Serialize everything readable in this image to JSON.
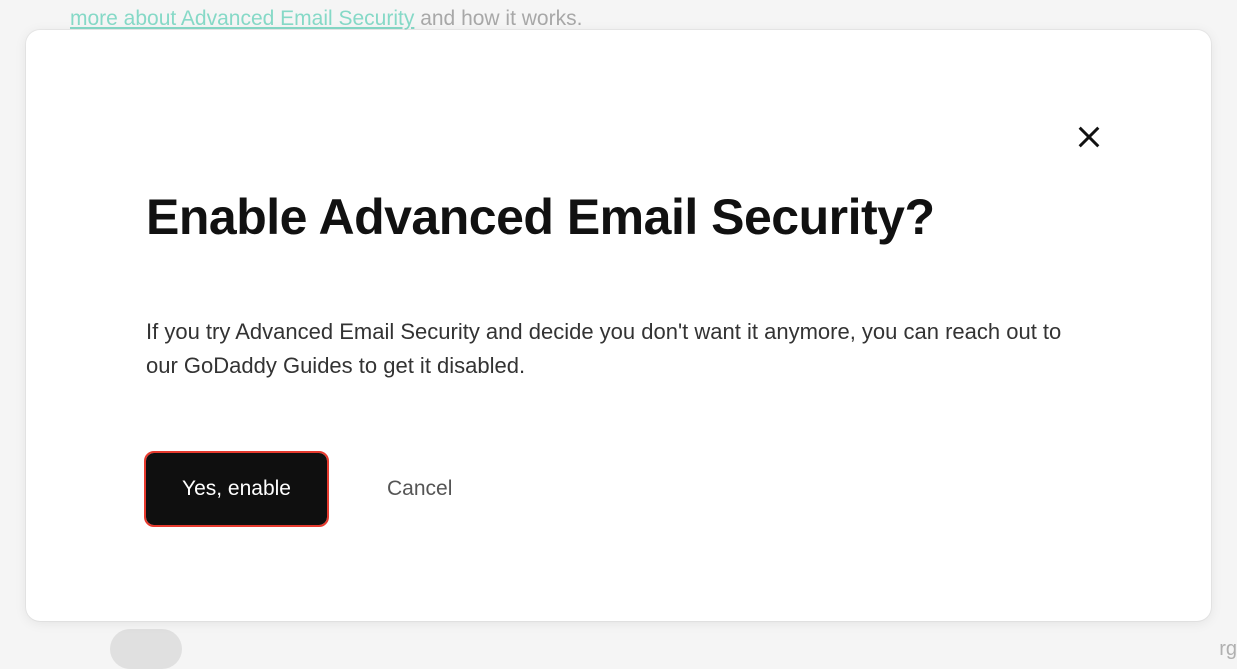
{
  "background": {
    "link_text": "more about Advanced Email Security",
    "trailing_text": " and how it works.",
    "right_fragment": "rg"
  },
  "modal": {
    "title": "Enable Advanced Email Security?",
    "body": "If you try Advanced Email Security and decide you don't want it anymore, you can reach out to our GoDaddy Guides to get it disabled.",
    "primary_label": "Yes, enable",
    "secondary_label": "Cancel"
  }
}
